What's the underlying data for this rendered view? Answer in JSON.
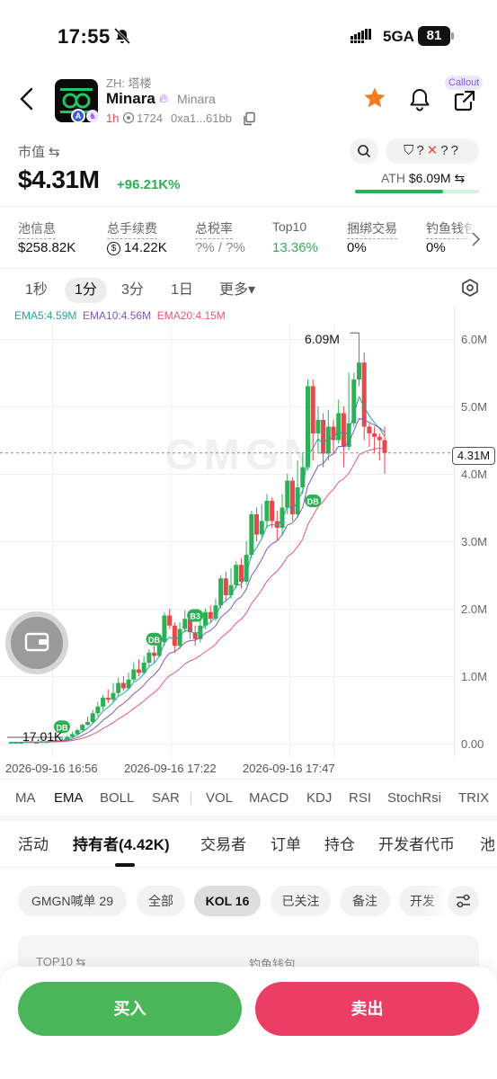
{
  "status": {
    "time": "17:55",
    "network": "5GA",
    "battery": "81"
  },
  "token": {
    "zh_name": "ZH: 塔楼",
    "name": "Minara",
    "sub_name": "Minara",
    "age": "1h",
    "views": "1724",
    "address": "0xa1...61bb",
    "callout": "Callout"
  },
  "market": {
    "label": "市值 ⇆",
    "value": "$4.31M",
    "change": "+96.21K%",
    "risk_q1": "?",
    "risk_x": "✕",
    "risk_q2": "?",
    "risk_q3": "?",
    "ath_label": "ATH",
    "ath_value": "$6.09M ⇆",
    "ath_fraction": 0.71
  },
  "stats": [
    {
      "label": "池信息",
      "value": "$258.82K"
    },
    {
      "label": "总手续费",
      "value": "14.22K"
    },
    {
      "label": "总税率",
      "value": "?% / ?%"
    },
    {
      "label": "Top10",
      "value": "13.36%"
    },
    {
      "label": "捆绑交易",
      "value": "0%"
    },
    {
      "label": "钓鱼钱包",
      "value": "0%"
    }
  ],
  "timeframes": [
    "1秒",
    "1分",
    "3分",
    "1日",
    "更多▾"
  ],
  "chart_data": {
    "type": "candlestick",
    "legend": [
      "EMA5:4.59M",
      "EMA10:4.56M",
      "EMA20:4.15M"
    ],
    "y_ticks": [
      "6.0M",
      "5.0M",
      "4.0M",
      "3.0M",
      "2.0M",
      "1.0M",
      "0.00"
    ],
    "ylim": [
      0,
      6.5
    ],
    "x_ticks": [
      "2026-09-16 16:56",
      "2026-09-16 17:22",
      "2026-09-16 17:47"
    ],
    "current_price": "4.31M",
    "high_label": "6.09M",
    "low_label": "17.01K",
    "markers": [
      "DB",
      "DB",
      "B3",
      "DB"
    ],
    "watermark": "GMGN",
    "candles": [
      [
        0.02,
        0.02,
        0.03,
        0.02
      ],
      [
        0.02,
        0.02,
        0.03,
        0.02
      ],
      [
        0.02,
        0.02,
        0.03,
        0.02
      ],
      [
        0.02,
        0.03,
        0.04,
        0.02
      ],
      [
        0.03,
        0.02,
        0.04,
        0.02
      ],
      [
        0.02,
        0.02,
        0.03,
        0.02
      ],
      [
        0.02,
        0.03,
        0.04,
        0.02
      ],
      [
        0.03,
        0.03,
        0.04,
        0.02
      ],
      [
        0.03,
        0.05,
        0.06,
        0.03
      ],
      [
        0.05,
        0.04,
        0.06,
        0.04
      ],
      [
        0.04,
        0.06,
        0.08,
        0.04
      ],
      [
        0.06,
        0.1,
        0.12,
        0.05
      ],
      [
        0.1,
        0.14,
        0.18,
        0.09
      ],
      [
        0.14,
        0.2,
        0.22,
        0.12
      ],
      [
        0.2,
        0.28,
        0.3,
        0.18
      ],
      [
        0.28,
        0.32,
        0.4,
        0.26
      ],
      [
        0.32,
        0.45,
        0.5,
        0.3
      ],
      [
        0.45,
        0.55,
        0.62,
        0.4
      ],
      [
        0.55,
        0.68,
        0.72,
        0.5
      ],
      [
        0.68,
        0.65,
        0.8,
        0.6
      ],
      [
        0.65,
        0.75,
        0.9,
        0.62
      ],
      [
        0.75,
        0.9,
        0.98,
        0.7
      ],
      [
        0.9,
        0.82,
        1.0,
        0.78
      ],
      [
        0.82,
        0.95,
        1.05,
        0.8
      ],
      [
        0.95,
        1.1,
        1.2,
        0.92
      ],
      [
        1.1,
        1.05,
        1.25,
        1.0
      ],
      [
        1.05,
        1.2,
        1.3,
        1.02
      ],
      [
        1.2,
        1.35,
        1.4,
        1.15
      ],
      [
        1.35,
        1.3,
        1.45,
        1.2
      ],
      [
        1.3,
        1.5,
        1.6,
        1.28
      ],
      [
        1.5,
        1.9,
        1.95,
        1.45
      ],
      [
        1.9,
        1.75,
        2.0,
        1.7
      ],
      [
        1.75,
        1.45,
        1.8,
        1.35
      ],
      [
        1.45,
        1.7,
        1.8,
        1.4
      ],
      [
        1.7,
        1.85,
        1.98,
        1.65
      ],
      [
        1.85,
        1.65,
        1.9,
        1.55
      ],
      [
        1.65,
        1.55,
        1.75,
        1.45
      ],
      [
        1.55,
        1.75,
        1.82,
        1.5
      ],
      [
        1.75,
        1.95,
        2.0,
        1.7
      ],
      [
        1.95,
        1.85,
        2.05,
        1.8
      ],
      [
        1.85,
        2.05,
        2.15,
        1.82
      ],
      [
        2.05,
        2.45,
        2.5,
        2.0
      ],
      [
        2.45,
        2.2,
        2.55,
        2.1
      ],
      [
        2.2,
        2.35,
        2.6,
        2.15
      ],
      [
        2.35,
        2.65,
        2.7,
        2.3
      ],
      [
        2.65,
        2.4,
        2.75,
        2.3
      ],
      [
        2.4,
        2.8,
        3.0,
        2.35
      ],
      [
        2.8,
        3.4,
        3.45,
        2.75
      ],
      [
        3.4,
        3.1,
        3.5,
        3.0
      ],
      [
        3.1,
        3.3,
        3.55,
        3.05
      ],
      [
        3.3,
        3.6,
        3.7,
        3.2
      ],
      [
        3.6,
        3.3,
        3.65,
        3.2
      ],
      [
        3.3,
        3.2,
        3.45,
        3.0
      ],
      [
        3.2,
        3.5,
        3.7,
        3.1
      ],
      [
        3.5,
        3.9,
        4.0,
        3.4
      ],
      [
        3.9,
        3.4,
        3.95,
        3.3
      ],
      [
        3.4,
        3.8,
        4.2,
        3.35
      ],
      [
        3.8,
        4.1,
        4.3,
        3.7
      ],
      [
        4.1,
        5.3,
        5.4,
        4.05
      ],
      [
        5.3,
        4.6,
        5.4,
        4.2
      ],
      [
        4.6,
        4.8,
        5.0,
        4.3
      ],
      [
        4.8,
        4.3,
        4.9,
        4.1
      ],
      [
        4.3,
        4.7,
        4.95,
        4.2
      ],
      [
        4.7,
        4.5,
        4.8,
        4.3
      ],
      [
        4.5,
        4.9,
        5.1,
        4.45
      ],
      [
        4.9,
        4.4,
        5.0,
        4.1
      ],
      [
        4.4,
        4.75,
        5.5,
        4.35
      ],
      [
        4.75,
        5.4,
        5.5,
        4.7
      ],
      [
        5.4,
        5.65,
        6.09,
        5.3
      ],
      [
        5.65,
        4.7,
        5.8,
        4.5
      ],
      [
        4.7,
        4.6,
        4.75,
        4.4
      ],
      [
        4.6,
        4.55,
        4.7,
        4.3
      ],
      [
        4.55,
        4.5,
        4.6,
        4.2
      ],
      [
        4.5,
        4.31,
        4.7,
        4.0
      ]
    ]
  },
  "indicators": [
    "MA",
    "EMA",
    "BOLL",
    "SAR",
    "VOL",
    "MACD",
    "KDJ",
    "RSI",
    "StochRsi",
    "TRIX"
  ],
  "tabs": [
    "活动",
    "持有者(4.42K)",
    "交易者",
    "订单",
    "持仓",
    "开发者代币",
    "池"
  ],
  "chips": [
    "GMGN喊单 29",
    "全部",
    "KOL 16",
    "已关注",
    "备注",
    "开发"
  ],
  "card": {
    "left": "TOP10 ⇆",
    "right": "钓鱼钱包"
  },
  "actions": {
    "buy": "买入",
    "sell": "卖出"
  },
  "colors": {
    "up": "#2bb153",
    "down": "#e5484d",
    "buy": "#4bb55a",
    "sell": "#ec3e64"
  }
}
